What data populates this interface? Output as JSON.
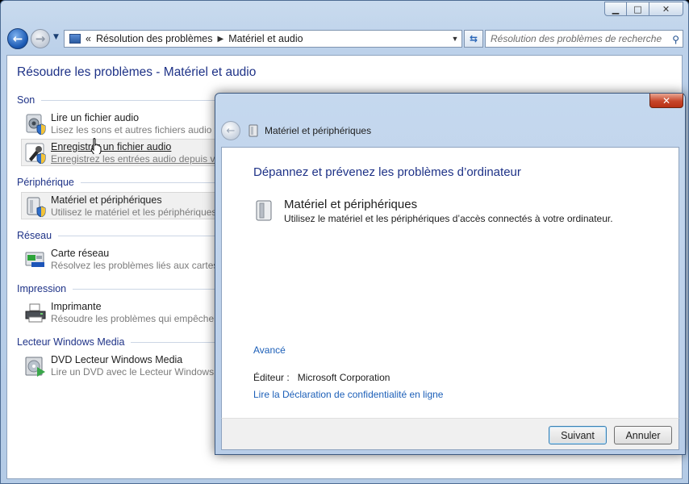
{
  "window": {
    "caption_buttons": {
      "minimize": "▁",
      "maximize": "□",
      "close": "✕"
    }
  },
  "nav": {
    "back_glyph": "←",
    "forward_glyph": "→",
    "address": {
      "chevrons": "«",
      "crumbs": [
        "Résolution des problèmes",
        "Matériel et audio"
      ],
      "separator": "▶"
    },
    "search_placeholder": "Résolution des problèmes de recherche"
  },
  "main": {
    "title": "Résoudre les problèmes - Matériel et audio",
    "categories": [
      {
        "label": "Son",
        "items": [
          {
            "title": "Lire un fichier audio",
            "desc": "Lisez les sons et autres fichiers audio te"
          },
          {
            "title": "Enregistrer un fichier audio",
            "desc": "Enregistrez les entrées audio depuis vo"
          }
        ]
      },
      {
        "label": "Périphérique",
        "items": [
          {
            "title": "Matériel et périphériques",
            "desc": "Utilisez le matériel et les périphériques"
          }
        ]
      },
      {
        "label": "Réseau",
        "items": [
          {
            "title": "Carte réseau",
            "desc": "Résolvez les problèmes liés aux cartes E"
          }
        ]
      },
      {
        "label": "Impression",
        "items": [
          {
            "title": "Imprimante",
            "desc": "Résoudre les problèmes qui empêchen"
          }
        ]
      },
      {
        "label": "Lecteur Windows Media",
        "items": [
          {
            "title": "DVD Lecteur Windows Media",
            "desc": "Lire un DVD avec le Lecteur Windows M"
          }
        ]
      }
    ]
  },
  "dialog": {
    "close_glyph": "✕",
    "breadcrumb": "Matériel et périphériques",
    "heading": "Dépannez et prévenez les problèmes d’ordinateur",
    "item_title": "Matériel et périphériques",
    "item_desc": "Utilisez le matériel et les périphériques d’accès connectés à votre ordinateur.",
    "advanced_link": "Avancé",
    "publisher_label": "Éditeur :",
    "publisher_value": "Microsoft Corporation",
    "privacy_link": "Lire la Déclaration de confidentialité en ligne",
    "next_button": "Suivant",
    "cancel_button": "Annuler"
  }
}
